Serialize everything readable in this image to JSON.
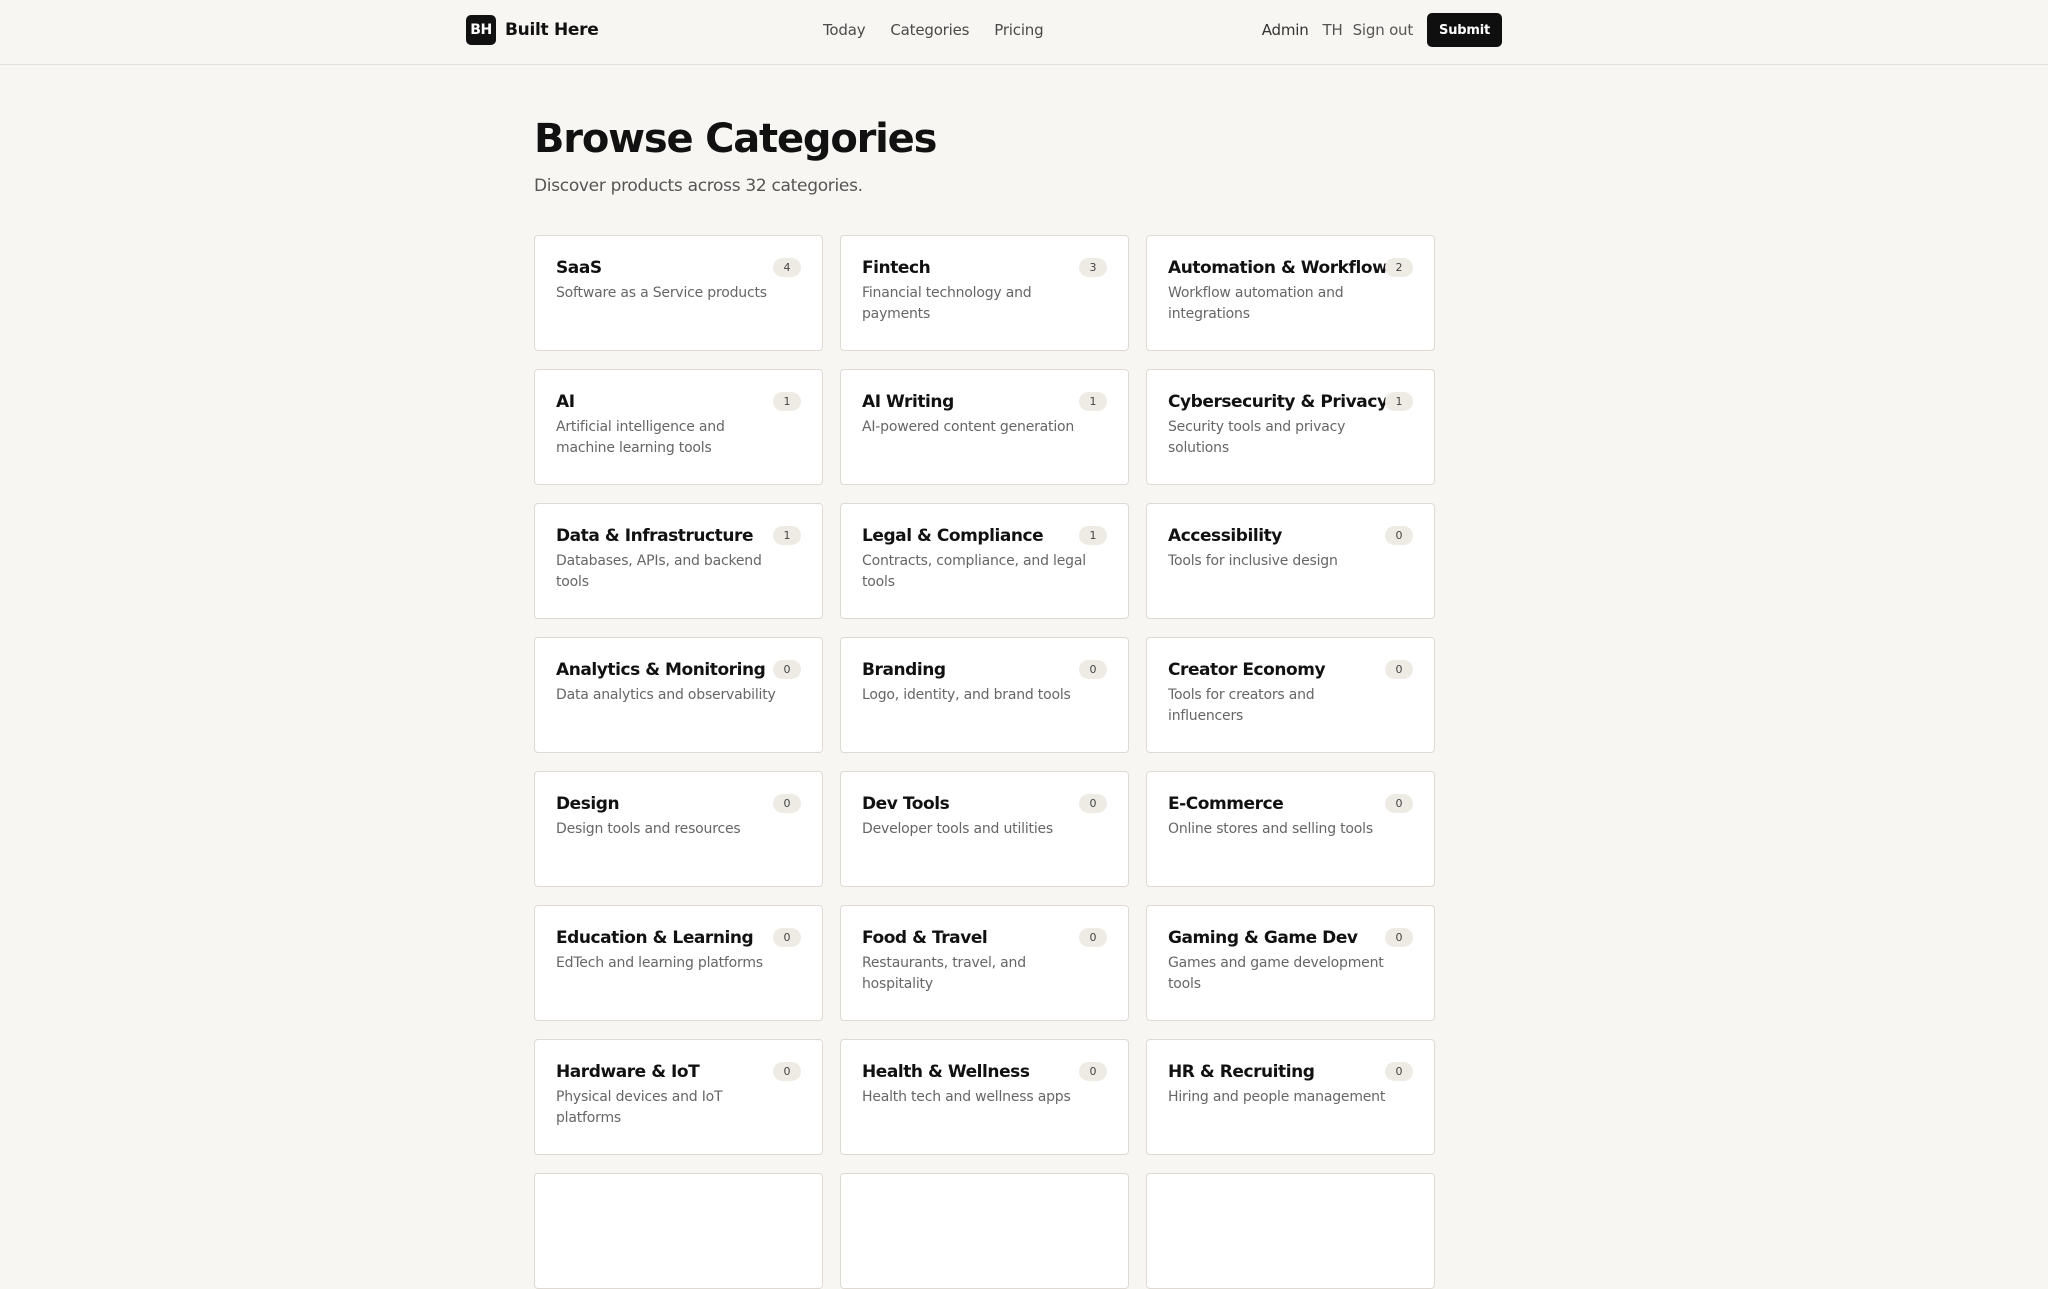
{
  "header": {
    "logo_text": "BH",
    "brand_name": "Built Here",
    "nav": [
      "Today",
      "Categories",
      "Pricing"
    ],
    "admin_label": "Admin",
    "user_initials": "TH",
    "signout_label": "Sign out",
    "submit_label": "Submit"
  },
  "page": {
    "title": "Browse Categories",
    "subtitle": "Discover products across 32 categories."
  },
  "categories": [
    {
      "name": "SaaS",
      "description": "Software as a Service products",
      "count": "4"
    },
    {
      "name": "Fintech",
      "description": "Financial technology and payments",
      "count": "3"
    },
    {
      "name": "Automation & Workflow",
      "description": "Workflow automation and integrations",
      "count": "2"
    },
    {
      "name": "AI",
      "description": "Artificial intelligence and machine learning tools",
      "count": "1"
    },
    {
      "name": "AI Writing",
      "description": "AI-powered content generation",
      "count": "1"
    },
    {
      "name": "Cybersecurity & Privacy",
      "description": "Security tools and privacy solutions",
      "count": "1"
    },
    {
      "name": "Data & Infrastructure",
      "description": "Databases, APIs, and backend tools",
      "count": "1"
    },
    {
      "name": "Legal & Compliance",
      "description": "Contracts, compliance, and legal tools",
      "count": "1"
    },
    {
      "name": "Accessibility",
      "description": "Tools for inclusive design",
      "count": "0"
    },
    {
      "name": "Analytics & Monitoring",
      "description": "Data analytics and observability",
      "count": "0"
    },
    {
      "name": "Branding",
      "description": "Logo, identity, and brand tools",
      "count": "0"
    },
    {
      "name": "Creator Economy",
      "description": "Tools for creators and influencers",
      "count": "0"
    },
    {
      "name": "Design",
      "description": "Design tools and resources",
      "count": "0"
    },
    {
      "name": "Dev Tools",
      "description": "Developer tools and utilities",
      "count": "0"
    },
    {
      "name": "E-Commerce",
      "description": "Online stores and selling tools",
      "count": "0"
    },
    {
      "name": "Education & Learning",
      "description": "EdTech and learning platforms",
      "count": "0"
    },
    {
      "name": "Food & Travel",
      "description": "Restaurants, travel, and hospitality",
      "count": "0"
    },
    {
      "name": "Gaming & Game Dev",
      "description": "Games and game development tools",
      "count": "0"
    },
    {
      "name": "Hardware & IoT",
      "description": "Physical devices and IoT platforms",
      "count": "0"
    },
    {
      "name": "Health & Wellness",
      "description": "Health tech and wellness apps",
      "count": "0"
    },
    {
      "name": "HR & Recruiting",
      "description": "Hiring and people management",
      "count": "0"
    },
    {
      "name": "",
      "description": "",
      "count": ""
    },
    {
      "name": "",
      "description": "",
      "count": ""
    },
    {
      "name": "",
      "description": "",
      "count": ""
    }
  ],
  "colors": {
    "background": "#f8f6f2",
    "card": "#ffffff",
    "border": "#dedad3",
    "primary": "#111111",
    "badge": "#eeebe5"
  }
}
